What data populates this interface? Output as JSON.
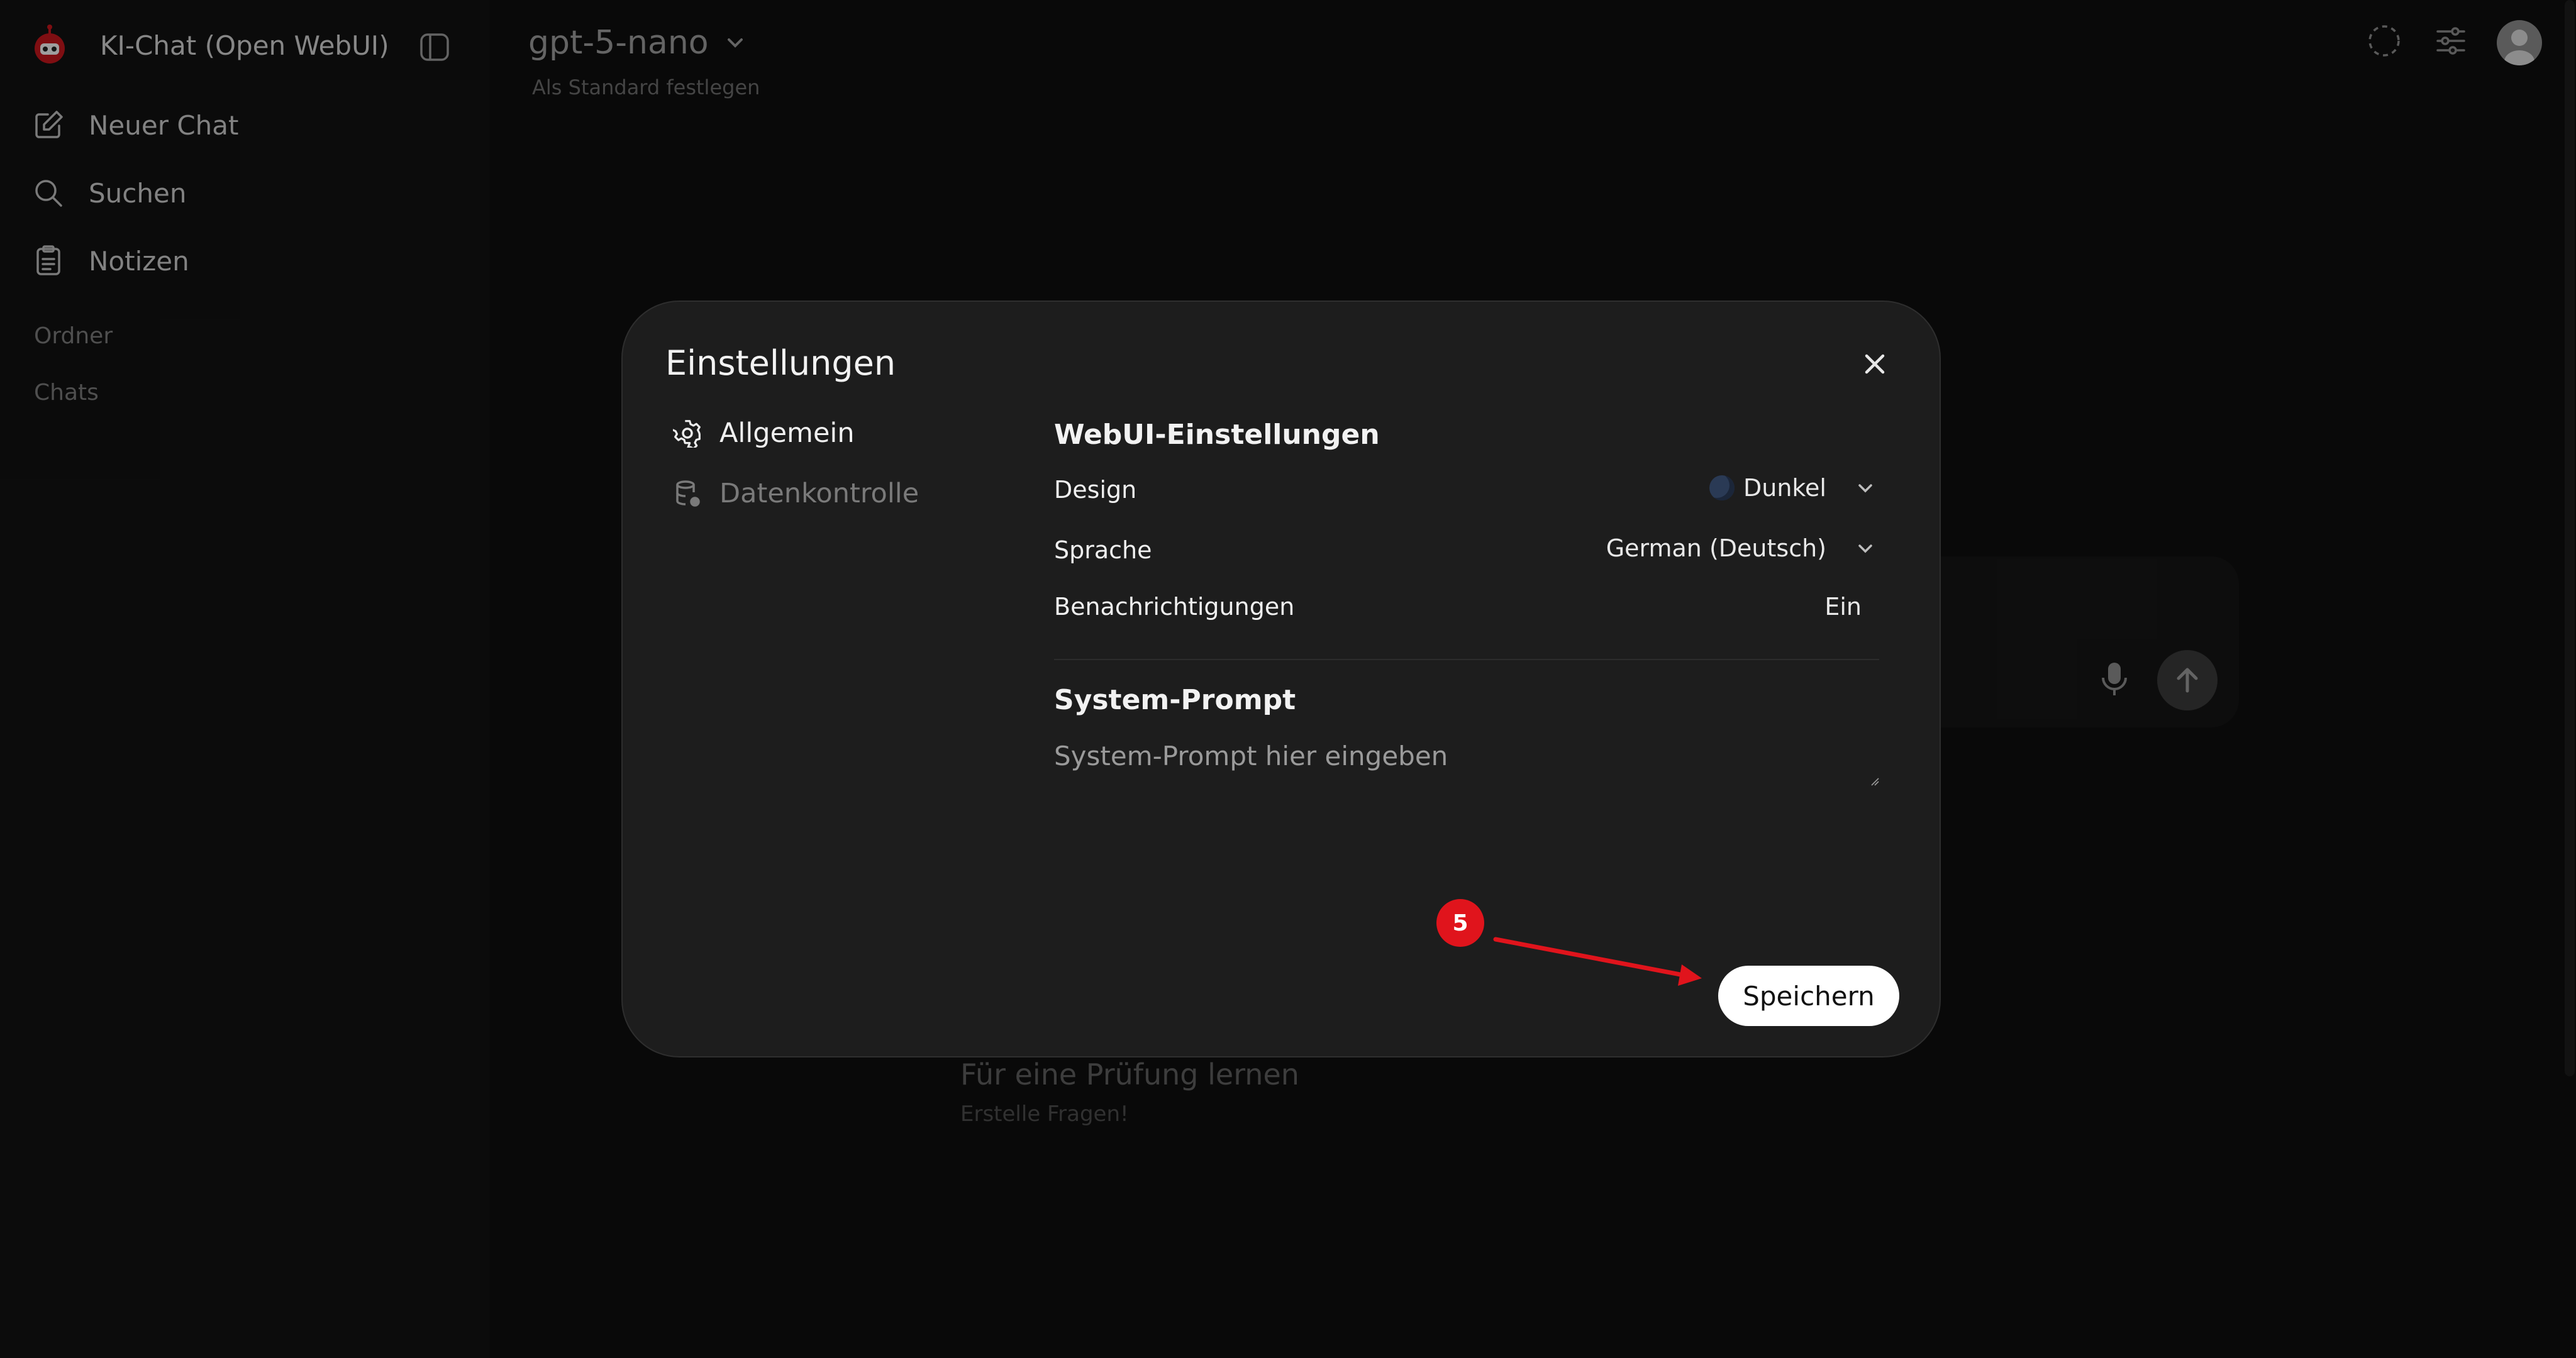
{
  "app": {
    "title": "KI-Chat (Open WebUI)"
  },
  "sidebar": {
    "items": [
      {
        "label": "Neuer Chat",
        "icon": "edit-icon"
      },
      {
        "label": "Suchen",
        "icon": "search-icon"
      },
      {
        "label": "Notizen",
        "icon": "notes-icon"
      }
    ],
    "sections": [
      "Ordner",
      "Chats"
    ]
  },
  "header": {
    "model": "gpt-5-nano",
    "set_default": "Als Standard festlegen"
  },
  "suggestion": {
    "title": "Für eine Prüfung lernen",
    "subtitle": "Erstelle Fragen!"
  },
  "modal": {
    "title": "Einstellungen",
    "tabs": [
      {
        "label": "Allgemein",
        "icon": "gear-icon",
        "active": true
      },
      {
        "label": "Datenkontrolle",
        "icon": "database-icon",
        "active": false
      }
    ],
    "webui": {
      "heading": "WebUI-Einstellungen",
      "design_label": "Design",
      "design_value": "Dunkel",
      "language_label": "Sprache",
      "language_value": "German (Deutsch)",
      "notifications_label": "Benachrichtigungen",
      "notifications_value": "Ein"
    },
    "system_prompt": {
      "heading": "System-Prompt",
      "placeholder": "System-Prompt hier eingeben"
    },
    "save_label": "Speichern"
  },
  "annotation": {
    "step": "5",
    "color": "#e0141c"
  }
}
